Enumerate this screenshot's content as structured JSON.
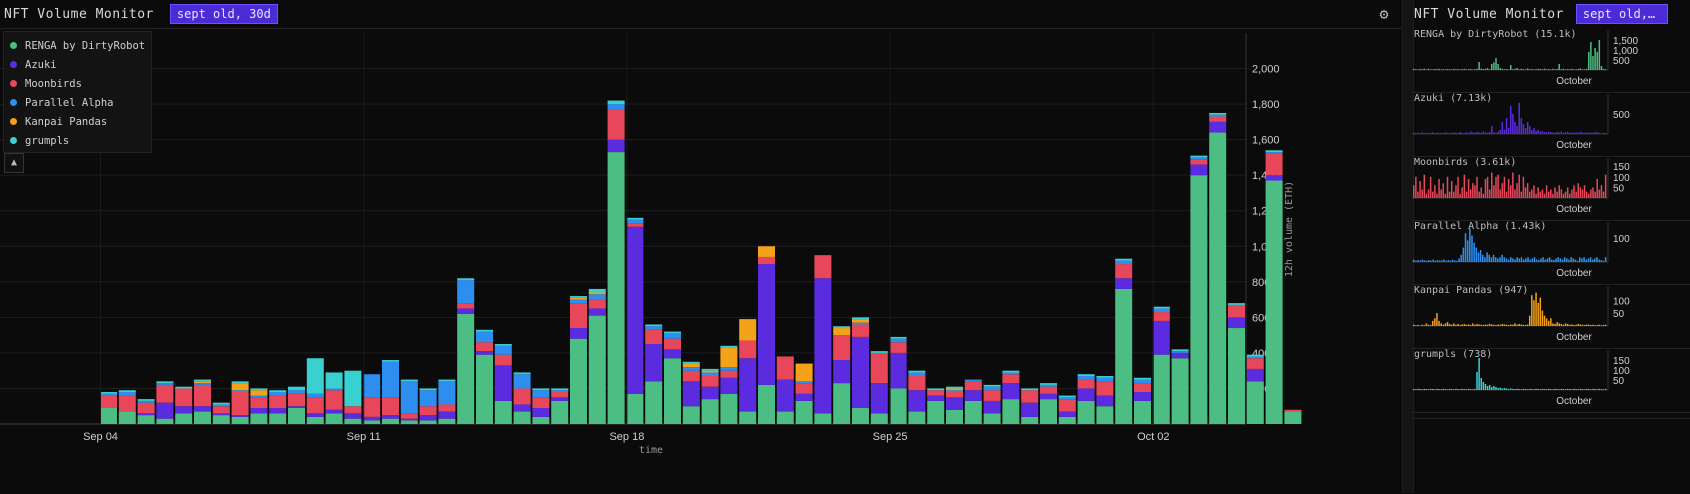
{
  "header": {
    "title": "NFT Volume Monitor",
    "badge": "sept old, 30d"
  },
  "right_header": {
    "title": "NFT Volume Monitor",
    "badge": "sept old,…"
  },
  "icons": {
    "settings": "gear-icon",
    "collapse": "chevron-up-icon"
  },
  "colors": {
    "RENGA by DirtyRobot": "#4cbd83",
    "Azuki": "#5b2be0",
    "Moonbirds": "#e8475a",
    "Parallel Alpha": "#2d8ef0",
    "Kanpai Pandas": "#f4a21a",
    "grumpls": "#3ad0cf"
  },
  "chart_data": [
    {
      "type": "bar",
      "stacked": true,
      "xlabel": "time",
      "ylabel": "12h volume (ETH)",
      "ylim": [
        0,
        2200
      ],
      "yticks": [
        200,
        400,
        600,
        800,
        1000,
        1200,
        1400,
        1600,
        1800,
        2000
      ],
      "xtick_labels": [
        "Sep 04",
        "Sep 11",
        "Sep 18",
        "Sep 25",
        "Oct 02"
      ],
      "legend_placement": "top-left",
      "grid": true,
      "series": [
        {
          "name": "RENGA by DirtyRobot",
          "values": [
            90,
            70,
            50,
            30,
            60,
            70,
            50,
            40,
            60,
            60,
            90,
            40,
            60,
            30,
            20,
            30,
            20,
            20,
            30,
            620,
            390,
            130,
            70,
            40,
            130,
            480,
            610,
            1530,
            170,
            240,
            370,
            100,
            140,
            170,
            70,
            220,
            70,
            130,
            60,
            230,
            90,
            60,
            200,
            70,
            130,
            80,
            130,
            60,
            140,
            40,
            140,
            40,
            130,
            100,
            760,
            130,
            390,
            370,
            1400,
            1640,
            540,
            240,
            1370,
            70
          ],
          "_segments": "first 12"
        },
        {
          "name": "Azuki",
          "values": [
            0,
            0,
            10,
            90,
            40,
            30,
            10,
            10,
            30,
            30,
            10,
            20,
            20,
            30,
            20,
            20,
            10,
            30,
            40,
            30,
            20,
            200,
            40,
            50,
            20,
            60,
            40,
            70,
            940,
            210,
            50,
            140,
            70,
            90,
            300,
            680,
            180,
            40,
            760,
            130,
            400,
            170,
            200,
            120,
            30,
            70,
            60,
            70,
            90,
            80,
            30,
            30,
            70,
            60,
            60,
            50,
            190,
            30,
            60,
            60,
            60,
            70,
            30,
            0
          ]
        },
        {
          "name": "Moonbirds",
          "values": [
            70,
            90,
            60,
            100,
            100,
            120,
            40,
            130,
            60,
            70,
            70,
            90,
            110,
            40,
            110,
            100,
            30,
            50,
            40,
            30,
            50,
            60,
            90,
            60,
            30,
            140,
            50,
            170,
            20,
            80,
            60,
            60,
            60,
            40,
            100,
            40,
            130,
            60,
            130,
            140,
            70,
            170,
            60,
            80,
            30,
            30,
            50,
            60,
            50,
            70,
            40,
            70,
            50,
            80,
            80,
            50,
            50,
            0,
            30,
            30,
            70,
            60,
            120,
            10
          ]
        },
        {
          "name": "Parallel Alpha",
          "values": [
            10,
            20,
            10,
            10,
            0,
            10,
            10,
            10,
            10,
            20,
            20,
            20,
            10,
            0,
            130,
            200,
            180,
            90,
            130,
            130,
            60,
            50,
            80,
            40,
            10,
            20,
            30,
            30,
            20,
            20,
            30,
            20,
            20,
            20,
            0,
            0,
            0,
            10,
            0,
            0,
            10,
            0,
            20,
            20,
            0,
            10,
            10,
            20,
            10,
            0,
            10,
            10,
            20,
            20,
            20,
            20,
            20,
            10,
            10,
            10,
            0,
            10,
            10,
            0
          ]
        },
        {
          "name": "Kanpai Pandas",
          "values": [
            0,
            0,
            0,
            0,
            0,
            10,
            0,
            40,
            30,
            0,
            0,
            0,
            0,
            0,
            0,
            0,
            0,
            0,
            0,
            0,
            0,
            0,
            0,
            0,
            0,
            10,
            10,
            0,
            0,
            0,
            0,
            20,
            10,
            110,
            120,
            60,
            0,
            100,
            0,
            40,
            20,
            0,
            0,
            0,
            0,
            10,
            0,
            0,
            0,
            0,
            0,
            0,
            0,
            0,
            0,
            0,
            0,
            0,
            0,
            0,
            0,
            0,
            0,
            0
          ]
        },
        {
          "name": "grumpls",
          "values": [
            10,
            10,
            10,
            10,
            10,
            10,
            10,
            10,
            10,
            10,
            20,
            200,
            90,
            200,
            0,
            10,
            10,
            10,
            10,
            10,
            10,
            10,
            10,
            10,
            10,
            10,
            20,
            20,
            10,
            10,
            10,
            10,
            10,
            10,
            0,
            0,
            0,
            0,
            0,
            10,
            10,
            10,
            10,
            10,
            10,
            10,
            0,
            10,
            10,
            10,
            10,
            10,
            10,
            10,
            10,
            10,
            10,
            10,
            10,
            10,
            10,
            10,
            10,
            0
          ]
        }
      ]
    },
    {
      "type": "bar",
      "name": "RENGA by DirtyRobot (15.1k)",
      "xtick_label": "October",
      "yticks": [
        "500",
        "1,000",
        "1,500"
      ],
      "ylim": [
        0,
        1800
      ],
      "values": [
        60,
        40,
        30,
        50,
        40,
        70,
        30,
        60,
        40,
        30,
        50,
        40,
        60,
        30,
        40,
        30,
        50,
        40,
        30,
        60,
        40,
        50,
        30,
        40,
        60,
        30,
        40,
        50,
        30,
        40,
        60,
        400,
        70,
        50,
        60,
        90,
        40,
        300,
        380,
        600,
        300,
        100,
        60,
        40,
        50,
        30,
        250,
        40,
        60,
        100,
        30,
        60,
        40,
        30,
        80,
        40,
        50,
        30,
        40,
        60,
        50,
        40,
        70,
        40,
        50,
        30,
        60,
        40,
        50,
        300,
        40,
        60,
        30,
        50,
        40,
        60,
        30,
        40,
        50,
        80,
        30,
        40,
        60,
        900,
        1400,
        700,
        1100,
        900,
        1500,
        200,
        60,
        40
      ]
    },
    {
      "type": "bar",
      "name": "Azuki (7.13k)",
      "xtick_label": "October",
      "yticks": [
        "500"
      ],
      "ylim": [
        0,
        900
      ],
      "values": [
        30,
        20,
        30,
        20,
        40,
        20,
        30,
        20,
        30,
        40,
        20,
        30,
        20,
        30,
        20,
        40,
        30,
        20,
        30,
        40,
        30,
        20,
        50,
        30,
        20,
        40,
        30,
        60,
        40,
        30,
        50,
        40,
        30,
        60,
        40,
        30,
        50,
        200,
        40,
        30,
        60,
        100,
        300,
        100,
        400,
        150,
        700,
        500,
        300,
        200,
        780,
        400,
        250,
        150,
        300,
        200,
        100,
        150,
        80,
        100,
        60,
        80,
        50,
        40,
        60,
        50,
        40,
        30,
        50,
        40,
        60,
        30,
        40,
        50,
        30,
        40,
        30,
        40,
        30,
        50,
        40,
        30,
        40,
        30,
        40,
        30,
        50,
        40,
        30,
        20,
        30,
        20
      ]
    },
    {
      "type": "bar",
      "name": "Moonbirds (3.61k)",
      "xtick_label": "October",
      "yticks": [
        "50",
        "100",
        "150"
      ],
      "ylim": [
        0,
        170
      ],
      "values": [
        60,
        100,
        30,
        80,
        40,
        110,
        20,
        40,
        100,
        30,
        60,
        20,
        90,
        40,
        70,
        20,
        100,
        30,
        80,
        30,
        60,
        100,
        20,
        50,
        110,
        30,
        90,
        40,
        70,
        60,
        100,
        30,
        50,
        20,
        90,
        100,
        40,
        120,
        60,
        100,
        110,
        40,
        70,
        100,
        30,
        90,
        60,
        120,
        40,
        70,
        110,
        30,
        100,
        50,
        70,
        30,
        40,
        60,
        20,
        50,
        30,
        40,
        20,
        60,
        30,
        40,
        20,
        50,
        30,
        60,
        40,
        20,
        30,
        50,
        20,
        40,
        60,
        30,
        70,
        50,
        40,
        60,
        30,
        20,
        40,
        50,
        30,
        90,
        40,
        60,
        30,
        110
      ]
    },
    {
      "type": "bar",
      "name": "Parallel Alpha (1.43k)",
      "xtick_label": "October",
      "yticks": [
        "100"
      ],
      "ylim": [
        0,
        150
      ],
      "values": [
        10,
        5,
        8,
        6,
        10,
        7,
        5,
        8,
        6,
        10,
        5,
        8,
        6,
        7,
        10,
        5,
        8,
        6,
        10,
        7,
        5,
        15,
        30,
        60,
        120,
        90,
        140,
        110,
        80,
        60,
        40,
        50,
        30,
        20,
        40,
        30,
        20,
        30,
        20,
        15,
        20,
        30,
        20,
        15,
        10,
        20,
        15,
        10,
        20,
        15,
        20,
        10,
        15,
        20,
        10,
        15,
        20,
        10,
        8,
        15,
        20,
        10,
        15,
        20,
        10,
        8,
        15,
        20,
        15,
        10,
        20,
        15,
        10,
        20,
        15,
        10,
        5,
        20,
        15,
        20,
        10,
        15,
        20,
        10,
        15,
        20,
        10,
        8,
        5,
        20
      ]
    },
    {
      "type": "bar",
      "name": "Kanpai Pandas (947)",
      "xtick_label": "October",
      "yticks": [
        "50",
        "100"
      ],
      "ylim": [
        0,
        140
      ],
      "values": [
        5,
        3,
        4,
        2,
        5,
        3,
        10,
        5,
        4,
        20,
        30,
        50,
        20,
        10,
        5,
        10,
        15,
        8,
        5,
        10,
        5,
        8,
        4,
        6,
        8,
        5,
        6,
        4,
        10,
        5,
        8,
        6,
        5,
        4,
        6,
        5,
        8,
        6,
        5,
        4,
        6,
        5,
        8,
        6,
        5,
        4,
        6,
        5,
        10,
        5,
        8,
        6,
        5,
        4,
        6,
        40,
        120,
        100,
        130,
        90,
        110,
        60,
        40,
        30,
        20,
        30,
        10,
        8,
        15,
        10,
        8,
        5,
        10,
        8,
        5,
        6,
        4,
        5,
        8,
        6,
        5,
        4,
        6,
        5,
        4,
        5,
        3,
        4,
        5,
        3,
        4,
        5
      ]
    },
    {
      "type": "bar",
      "name": "grumpls (738)",
      "xtick_label": "October",
      "yticks": [
        "50",
        "100",
        "150"
      ],
      "ylim": [
        0,
        180
      ],
      "values": [
        5,
        4,
        6,
        5,
        4,
        6,
        5,
        4,
        6,
        5,
        4,
        6,
        5,
        4,
        6,
        5,
        4,
        6,
        5,
        4,
        6,
        5,
        4,
        6,
        5,
        4,
        6,
        5,
        4,
        6,
        90,
        160,
        60,
        40,
        30,
        20,
        25,
        15,
        20,
        15,
        10,
        12,
        8,
        10,
        8,
        6,
        8,
        6,
        5,
        6,
        5,
        4,
        6,
        5,
        4,
        6,
        5,
        4,
        6,
        5,
        4,
        6,
        5,
        4,
        6,
        5,
        4,
        6,
        5,
        4,
        6,
        5,
        4,
        6,
        5,
        4,
        6,
        5,
        4,
        6,
        5,
        4,
        6,
        5,
        4,
        6,
        5,
        4,
        6,
        5,
        4,
        6
      ]
    }
  ]
}
